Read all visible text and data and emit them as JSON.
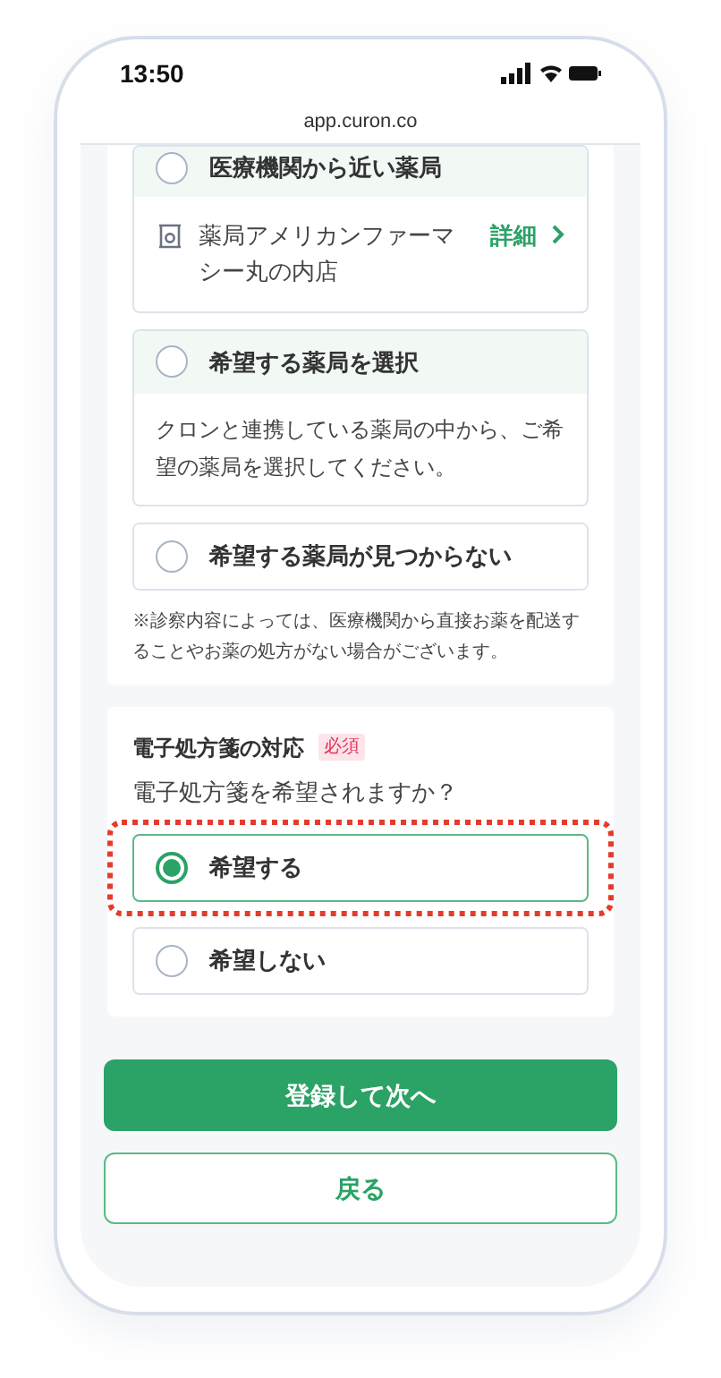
{
  "status_bar": {
    "time": "13:50"
  },
  "url_bar": {
    "url": "app.curon.co"
  },
  "pharmacy_options": [
    {
      "kind": "nearby",
      "label": "医療機関から近い薬局",
      "selected": false,
      "pharmacy_name": "薬局アメリカンファーマシー丸の内店",
      "details_link": "詳細"
    },
    {
      "kind": "choose",
      "label": "希望する薬局を選択",
      "selected": false,
      "description": "クロンと連携している薬局の中から、ご希望の薬局を選択してください。"
    },
    {
      "kind": "simple",
      "label": "希望する薬局が見つからない",
      "selected": false
    }
  ],
  "pharmacy_note": "※診察内容によっては、医療機関から直接お薬を配送することやお薬の処方がない場合がございます。",
  "e_prescription": {
    "title": "電子処方箋の対応",
    "required_badge": "必須",
    "question": "電子処方箋を希望されますか？",
    "options": [
      {
        "label": "希望する",
        "selected": true,
        "highlighted": true
      },
      {
        "label": "希望しない",
        "selected": false,
        "highlighted": false
      }
    ]
  },
  "buttons": {
    "primary": "登録して次へ",
    "secondary": "戻る"
  }
}
